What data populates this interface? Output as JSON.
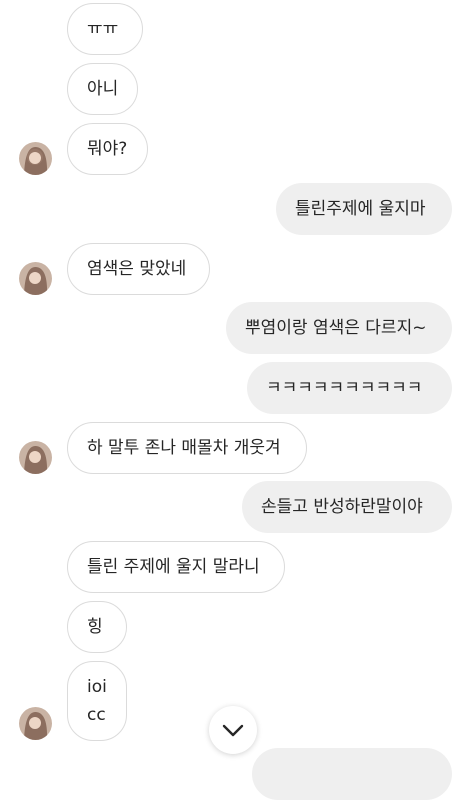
{
  "thread": {
    "messages": [
      {
        "side": "received",
        "text": "ㅠㅠ"
      },
      {
        "side": "received",
        "text": "아니"
      },
      {
        "side": "received",
        "text": "뭐야?"
      },
      {
        "side": "sent",
        "text": "틀린주제에 울지마"
      },
      {
        "side": "received",
        "text": "염색은 맞았네"
      },
      {
        "side": "sent",
        "text": "뿌염이랑 염색은 다르지~"
      },
      {
        "side": "sent",
        "text": "ㅋㅋㅋㅋㅋㅋㅋㅋㅋㅋ"
      },
      {
        "side": "received",
        "text": "하 말투 존나 매몰차 개웃겨"
      },
      {
        "side": "sent",
        "text": "손들고 반성하란말이야"
      },
      {
        "side": "received",
        "text": "틀린 주제에 울지 말라니"
      },
      {
        "side": "received",
        "text": "힝"
      },
      {
        "side": "received",
        "lines": [
          "ioi",
          "cc"
        ]
      }
    ]
  },
  "icons": {
    "scroll_down": "chevron-down-icon",
    "avatar": "user-avatar"
  },
  "colors": {
    "received_border": "#dbdbdb",
    "sent_background": "#efefef",
    "text": "#262626"
  }
}
